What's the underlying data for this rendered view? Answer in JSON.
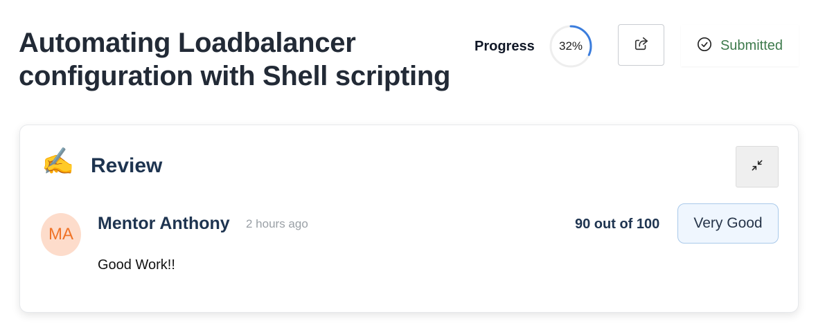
{
  "header": {
    "title_line1": "Automating Loadbalancer",
    "title_line2": "configuration with Shell scripting",
    "progress_label": "Progress",
    "progress_value": 0.32,
    "progress_text": "32%",
    "share_icon": "share-icon",
    "status_icon": "check-circle-icon",
    "status_text": "Submitted"
  },
  "review": {
    "emoji": "✍️",
    "title": "Review",
    "collapse_icon": "collapse-icon",
    "reviewer_initials": "MA",
    "reviewer_name": "Mentor Anthony",
    "time": "2 hours ago",
    "score": "90 out of 100",
    "rating": "Very Good",
    "comment": "Good Work!!"
  },
  "colors": {
    "progress_arc": "#3b7ddd",
    "status_green": "#3d7a4c",
    "avatar_bg": "#fddccb",
    "avatar_text": "#f07327",
    "rating_bg": "#eff6fe"
  }
}
